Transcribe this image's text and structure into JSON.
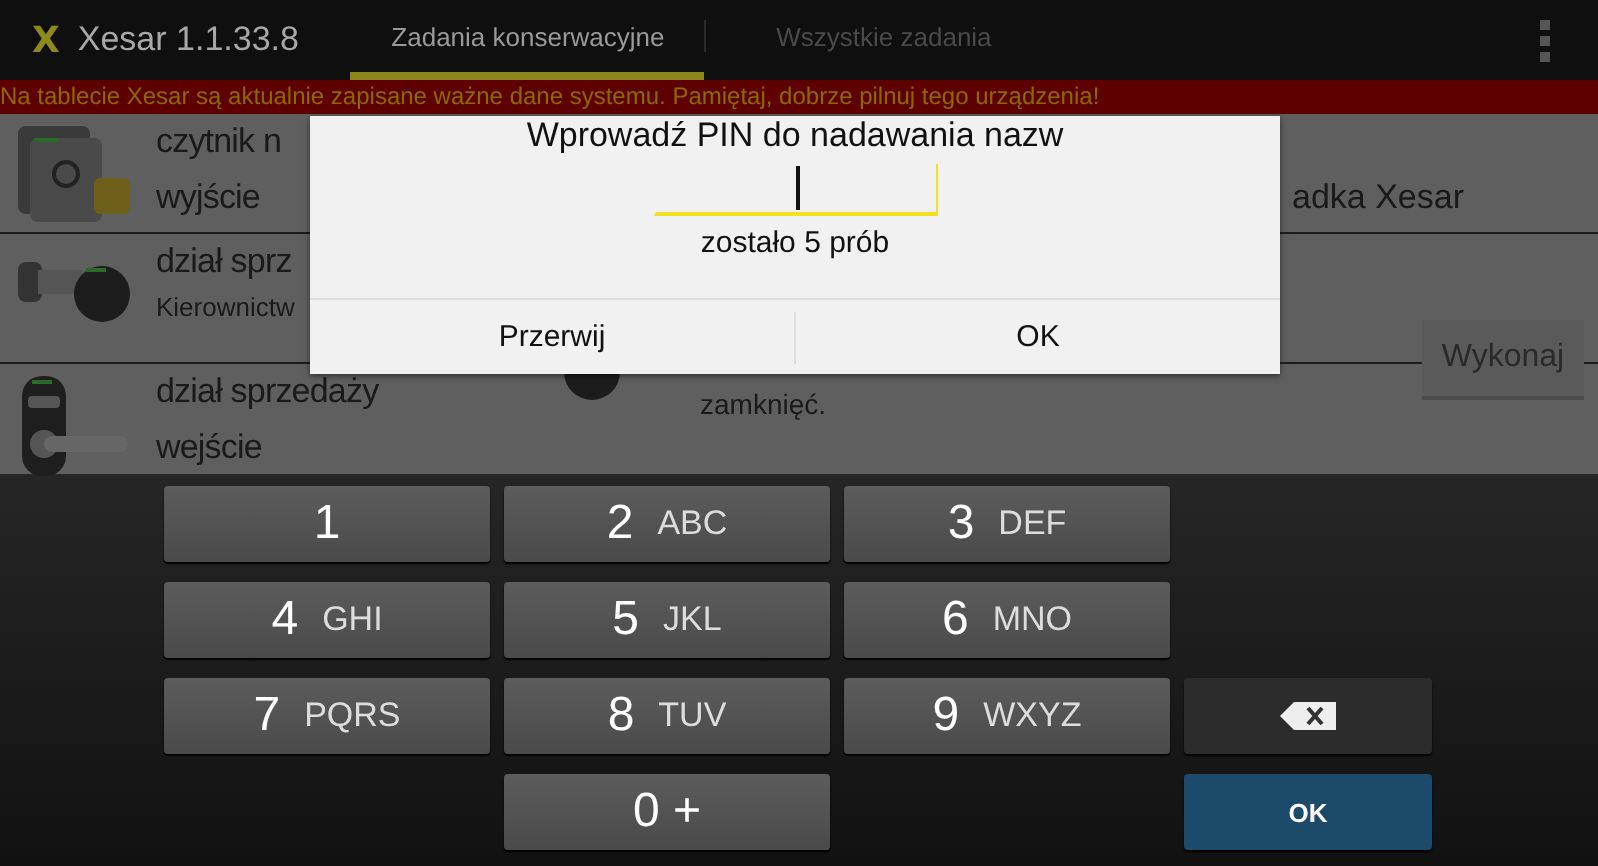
{
  "app_bar": {
    "logo": "X",
    "title": "Xesar 1.1.33.8",
    "tabs": [
      {
        "label": "Zadania konserwacyjne",
        "selected": true
      },
      {
        "label": "Wszystkie zadania",
        "selected": false
      }
    ]
  },
  "banner": {
    "text": "Na tablecie Xesar są aktualnie zapisane ważne dane systemu. Pamiętaj, dobrze pilnuj tego urządzenia!"
  },
  "tasks": [
    {
      "kind": "reader",
      "title_lines": [
        "czytnik n",
        "wyjście"
      ],
      "detail": "adka Xesar"
    },
    {
      "kind": "cylinder",
      "title_lines": [
        "dział sprz"
      ],
      "subtitle": "Kierownictw"
    },
    {
      "kind": "handle",
      "title_lines": [
        "dział sprzedaży",
        "wejście"
      ],
      "detail": "zamknięć."
    }
  ],
  "execute_button": {
    "label": "Wykonaj",
    "disabled": true
  },
  "dialog": {
    "title": "Wprowadź PIN do nadawania nazw",
    "attempts": "zostało 5 prób",
    "buttons": [
      "Przerwij",
      "OK"
    ]
  },
  "keypad": {
    "keys": [
      {
        "kind": "digit",
        "digit": "1"
      },
      {
        "kind": "digit",
        "digit": "2",
        "letters": "ABC"
      },
      {
        "kind": "digit",
        "digit": "3",
        "letters": "DEF"
      },
      {
        "kind": "blank"
      },
      {
        "kind": "digit",
        "digit": "4",
        "letters": "GHI"
      },
      {
        "kind": "digit",
        "digit": "5",
        "letters": "JKL"
      },
      {
        "kind": "digit",
        "digit": "6",
        "letters": "MNO"
      },
      {
        "kind": "blank"
      },
      {
        "kind": "digit",
        "digit": "7",
        "letters": "PQRS"
      },
      {
        "kind": "digit",
        "digit": "8",
        "letters": "TUV"
      },
      {
        "kind": "digit",
        "digit": "9",
        "letters": "WXYZ"
      },
      {
        "kind": "backspace"
      },
      {
        "kind": "blank"
      },
      {
        "kind": "digit",
        "digit": "0 +"
      },
      {
        "kind": "blank"
      },
      {
        "kind": "enter",
        "label": "OK"
      }
    ]
  }
}
